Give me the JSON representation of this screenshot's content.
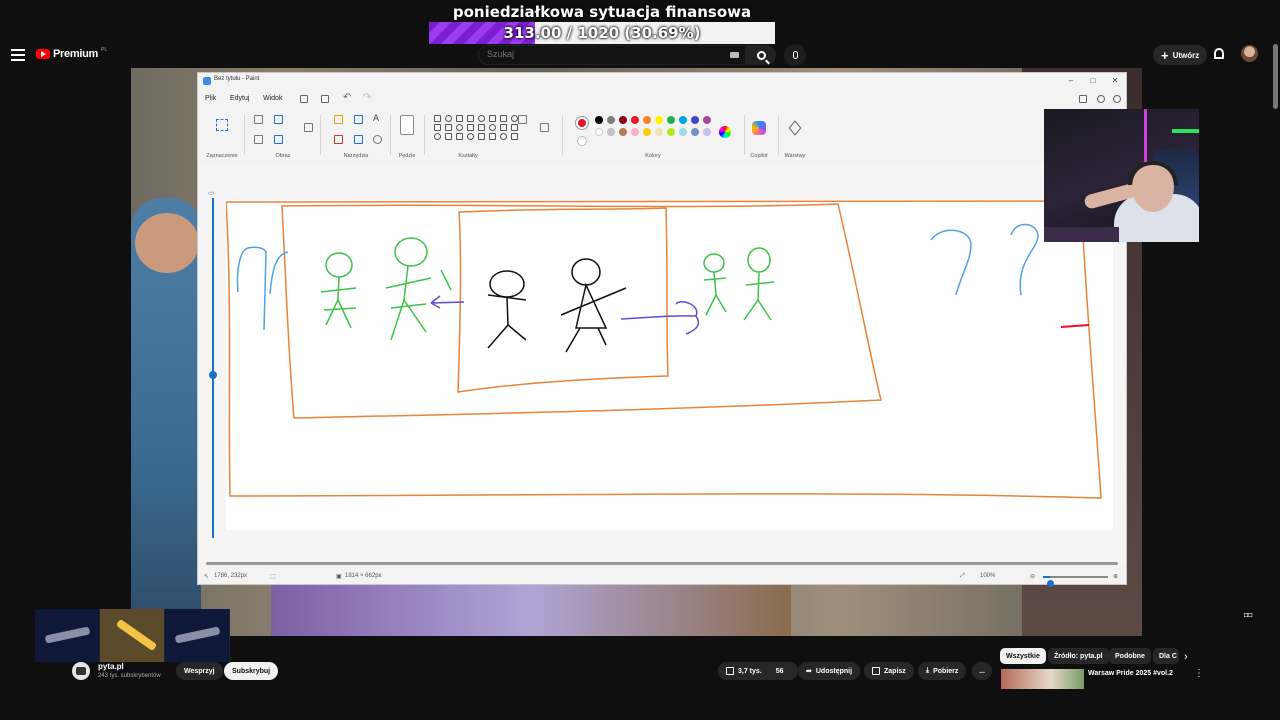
{
  "overlay": {
    "goal_title": "poniedziałkowa sytuacja finansowa",
    "goal_progress_text": "313.00 / 1020 (30.69%)",
    "goal_progress_fraction": 0.3069
  },
  "youtube": {
    "logo_text": "Premium",
    "logo_sup": "PL",
    "search_placeholder": "Szukaj",
    "create_label": "Utwórz"
  },
  "paint": {
    "title": "Bez tytułu - Paint",
    "menu": [
      "Plik",
      "Edytuj",
      "Widok"
    ],
    "ribbon_groups": [
      "Zaznaczenie",
      "Obraz",
      "Narzędzia",
      "Pędzle",
      "Kształty",
      "Kolory",
      "Copilot",
      "Warstwy"
    ],
    "primary_color": "#e81123",
    "palette": [
      "#000000",
      "#7f7f7f",
      "#880015",
      "#ed1c24",
      "#ff7f27",
      "#fff200",
      "#22b14c",
      "#00a2e8",
      "#3f48cc",
      "#a349a4",
      "#ffffff",
      "#c3c3c3",
      "#b97a57",
      "#ffaec9",
      "#ffc90e",
      "#efe4b0",
      "#b5e61d",
      "#99d9ea",
      "#7092be",
      "#c8bfe7"
    ],
    "status_position": "1786, 232px",
    "status_size": "1814 × 662px",
    "zoom_level": "100%",
    "zoom_fraction": 0.1,
    "vertical_zoom_fraction": 0.52
  },
  "channel": {
    "name": "pyta.pl",
    "subscribers": "243 tys. subskrybentów",
    "support_label": "Wesprzyj",
    "subscribe_label": "Subskrybuj"
  },
  "actions": {
    "likes": "3,7 tys.",
    "dislikes": "56",
    "share": "Udostępnij",
    "save": "Zapisz",
    "download": "Pobierz",
    "more": "..."
  },
  "chips": [
    "Wszystkie",
    "Źródło: pyta.pl",
    "Podobne",
    "Dla C"
  ],
  "recommendation": {
    "title": "Warsaw Pride 2025 #vol.2"
  },
  "colors": {
    "youtube_red": "#ff0000",
    "goal_purple": "#8a2be2",
    "drawing_orange": "#e8833a",
    "drawing_green": "#3cc34a",
    "drawing_blue": "#4fa3e0",
    "drawing_purple": "#5a4fd0"
  }
}
